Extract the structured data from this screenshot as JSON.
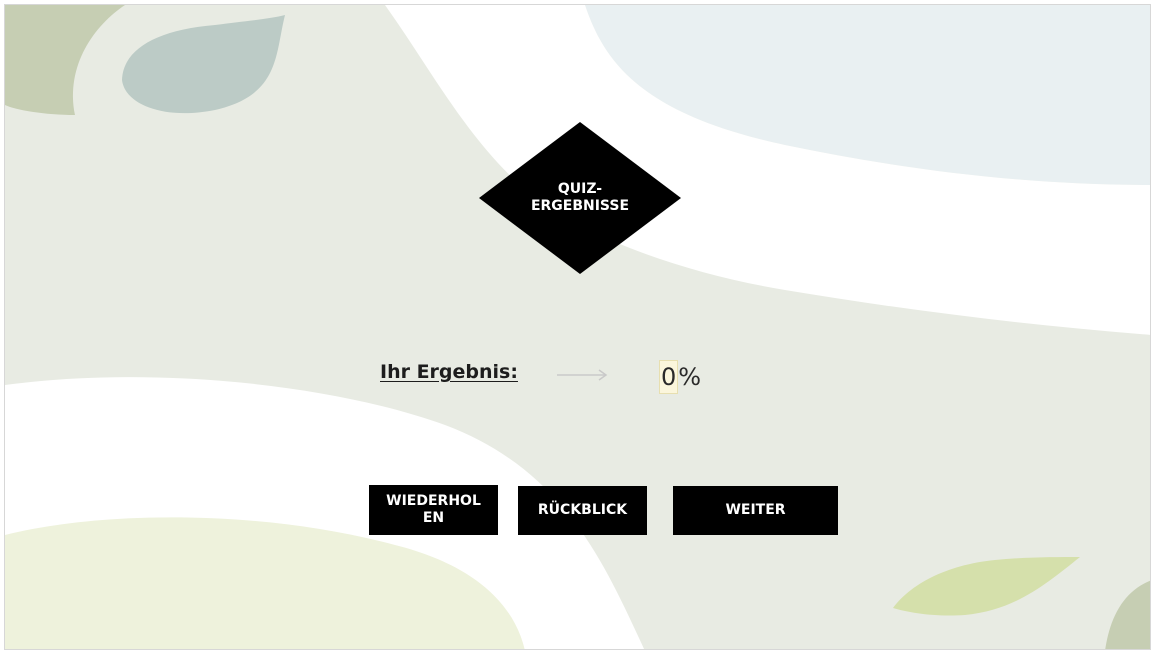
{
  "slide": {
    "title": "QUIZ-ERGEBNISSE",
    "result_label": "Ihr Ergebnis:",
    "score_value": "0",
    "score_unit": "%"
  },
  "buttons": {
    "retry_label": "WIEDERHOLEN",
    "review_label": "RÜCKBLICK",
    "next_label": "WEITER"
  },
  "colors": {
    "background": "#e8ebe3",
    "accent_dark": "#000000",
    "leaf_green": "#c8d6a0",
    "leaf_teal": "#b9c9c4",
    "sky": "#e9f0f2"
  },
  "icons": {
    "arrow": "arrow-right-icon"
  }
}
